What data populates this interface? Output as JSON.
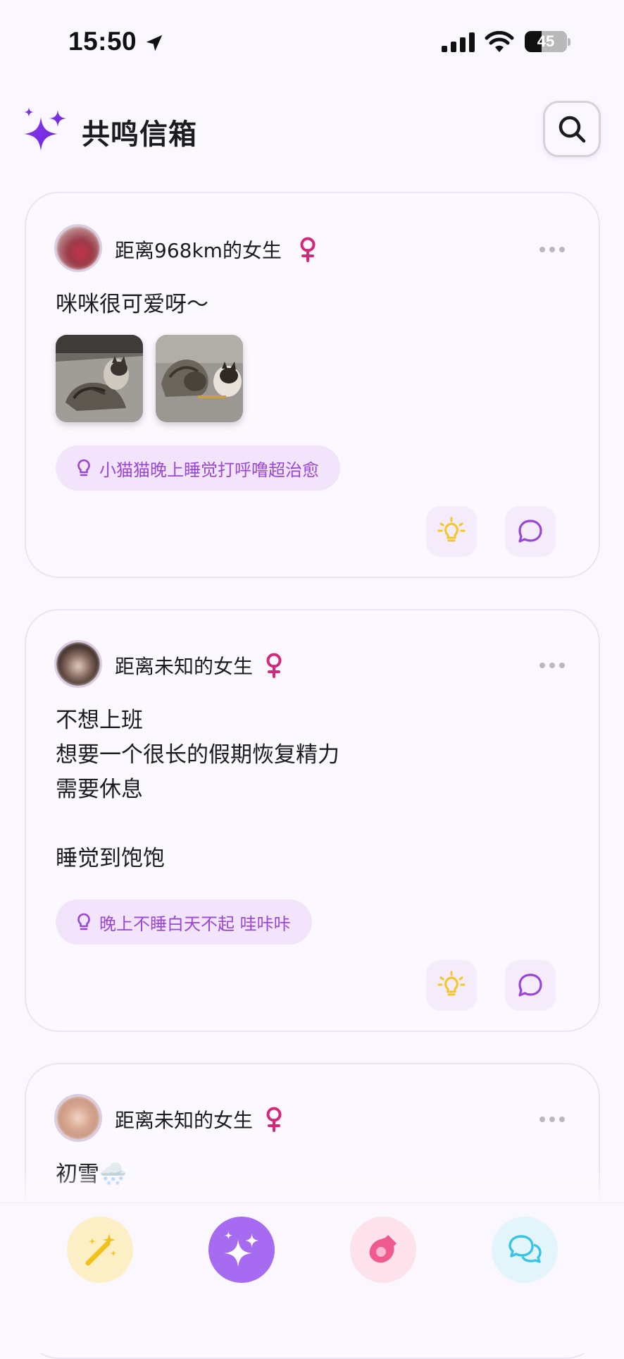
{
  "status_bar": {
    "time": "15:50",
    "battery": "45"
  },
  "header": {
    "title": "共鸣信箱",
    "logo_icon": "sparkles-icon",
    "search_icon": "search-icon"
  },
  "posts": [
    {
      "user": "距离968km的女生",
      "gender_icon": "female-icon",
      "text": "咪咪很可爱呀～",
      "images": [
        "cat-photo-1",
        "cat-photo-2"
      ],
      "tag": "小猫猫晚上睡觉打呼噜超治愈"
    },
    {
      "user": "距离未知的女生",
      "gender_icon": "female-icon",
      "text": "不想上班\n想要一个很长的假期恢复精力\n需要休息\n\n睡觉到饱饱",
      "images": [],
      "tag": "晚上不睡白天不起 哇咔咔"
    },
    {
      "user": "距离未知的女生",
      "gender_icon": "female-icon",
      "text": "初雪🌨️",
      "images": [],
      "tag": ""
    }
  ],
  "tab_bar": [
    {
      "name": "magic-wand",
      "icon": "magic-wand-icon",
      "color": "#fdefc5"
    },
    {
      "name": "sparkles",
      "icon": "sparkles-icon",
      "color": "#a66bf0",
      "active": true
    },
    {
      "name": "bottle",
      "icon": "bottle-icon",
      "color": "#fde2ec"
    },
    {
      "name": "chat",
      "icon": "chat-bubbles-icon",
      "color": "#e3f5fb"
    }
  ],
  "colors": {
    "accent": "#9a46d6",
    "background": "#fbf7fe",
    "female": "#d4297a",
    "bulb": "#f3c623"
  }
}
